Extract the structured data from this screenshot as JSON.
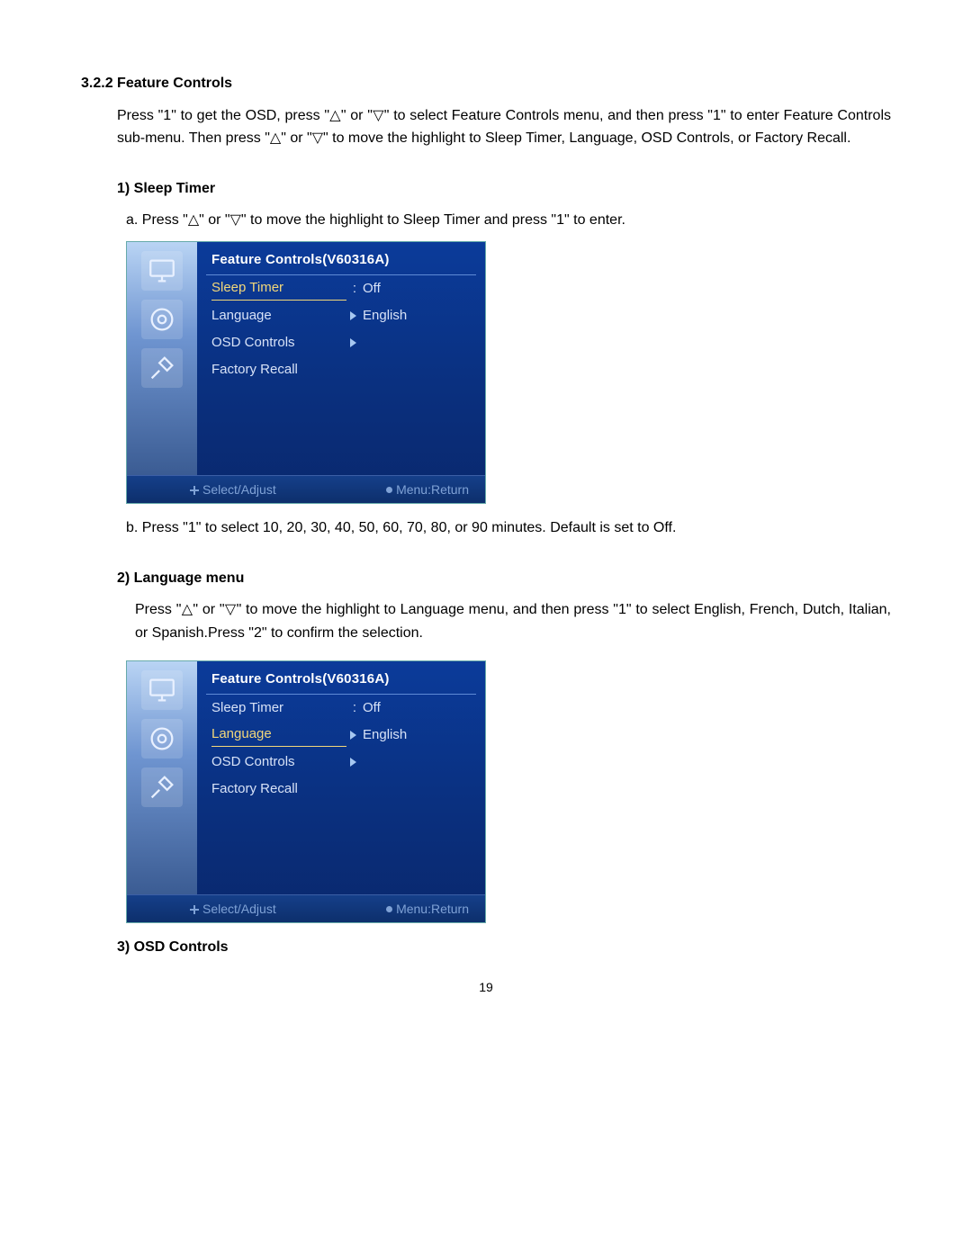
{
  "section": {
    "number": "3.2.2",
    "title": "Feature Controls",
    "intro": "Press \"1\" to get the OSD, press \"△\" or \"▽\" to select Feature Controls menu, and then press \"1\" to enter Feature Controls sub-menu. Then press \"△\" or \"▽\" to move the highlight to Sleep Timer, Language, OSD Controls, or Factory Recall."
  },
  "sleep_timer": {
    "heading": "1) Sleep Timer",
    "step_a": "a. Press \"△\" or \"▽\" to move the highlight to Sleep Timer and press \"1\" to enter.",
    "step_b": "b. Press \"1\" to select 10, 20, 30, 40, 50, 60, 70, 80, or 90 minutes. Default is set to Off."
  },
  "language_menu": {
    "heading": "2) Language menu",
    "para": "Press \"△\" or \"▽\" to move the highlight to Language menu, and then press \"1\" to select English, French, Dutch, Italian, or Spanish.Press \"2\" to confirm the selection."
  },
  "osd_controls_heading": "3) OSD Controls",
  "osd1": {
    "title": "Feature Controls(V60316A)",
    "rows": [
      {
        "label": "Sleep Timer",
        "mid": ":",
        "value": "Off",
        "selected": true
      },
      {
        "label": "Language",
        "mid": "▶",
        "value": "English",
        "selected": false
      },
      {
        "label": "OSD Controls",
        "mid": "▶",
        "value": "",
        "selected": false
      },
      {
        "label": "Factory Recall",
        "mid": "",
        "value": "",
        "selected": false
      }
    ],
    "footer_left": "Select/Adjust",
    "footer_right": "Menu:Return"
  },
  "osd2": {
    "title": "Feature Controls(V60316A)",
    "rows": [
      {
        "label": "Sleep Timer",
        "mid": ":",
        "value": "Off",
        "selected": false
      },
      {
        "label": "Language",
        "mid": "▶",
        "value": "English",
        "selected": true
      },
      {
        "label": "OSD Controls",
        "mid": "▶",
        "value": "",
        "selected": false
      },
      {
        "label": "Factory Recall",
        "mid": "",
        "value": "",
        "selected": false
      }
    ],
    "footer_left": "Select/Adjust",
    "footer_right": "Menu:Return"
  },
  "page_number": "19"
}
